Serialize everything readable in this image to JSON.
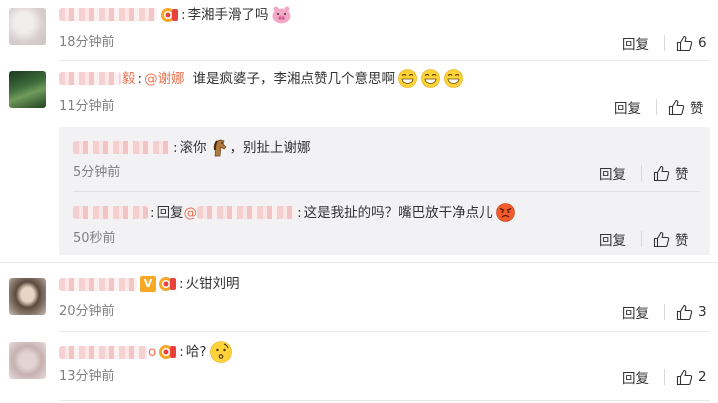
{
  "comments": [
    {
      "name_suffix": "",
      "text": "李湘手滑了吗",
      "time": "18分钟前",
      "reply_label": "回复",
      "likes": "6"
    },
    {
      "name_suffix": "毅",
      "mention": "@谢娜",
      "text": "谁是疯婆子，李湘点赞几个意思啊",
      "time": "11分钟前",
      "reply_label": "回复",
      "like_label": "赞"
    },
    {
      "name_suffix": "",
      "text": "火钳刘明",
      "time": "20分钟前",
      "reply_label": "回复",
      "likes": "3"
    },
    {
      "name_suffix": "o",
      "text": "哈?",
      "time": "13分钟前",
      "reply_label": "回复",
      "likes": "2"
    }
  ],
  "subreplies": [
    {
      "text_before_emoji": "滚你",
      "text_after_emoji": "，别扯上谢娜",
      "time": "5分钟前",
      "reply_label": "回复",
      "like_label": "赞"
    },
    {
      "reply_kw": "回复",
      "text": "这是我扯的吗？嘴巴放干净点儿",
      "time": "50秒前",
      "reply_label": "回复",
      "like_label": "赞"
    }
  ],
  "colors": {
    "accent": "#eb7350",
    "muted": "#808080",
    "subbox": "#f2f2f5"
  }
}
